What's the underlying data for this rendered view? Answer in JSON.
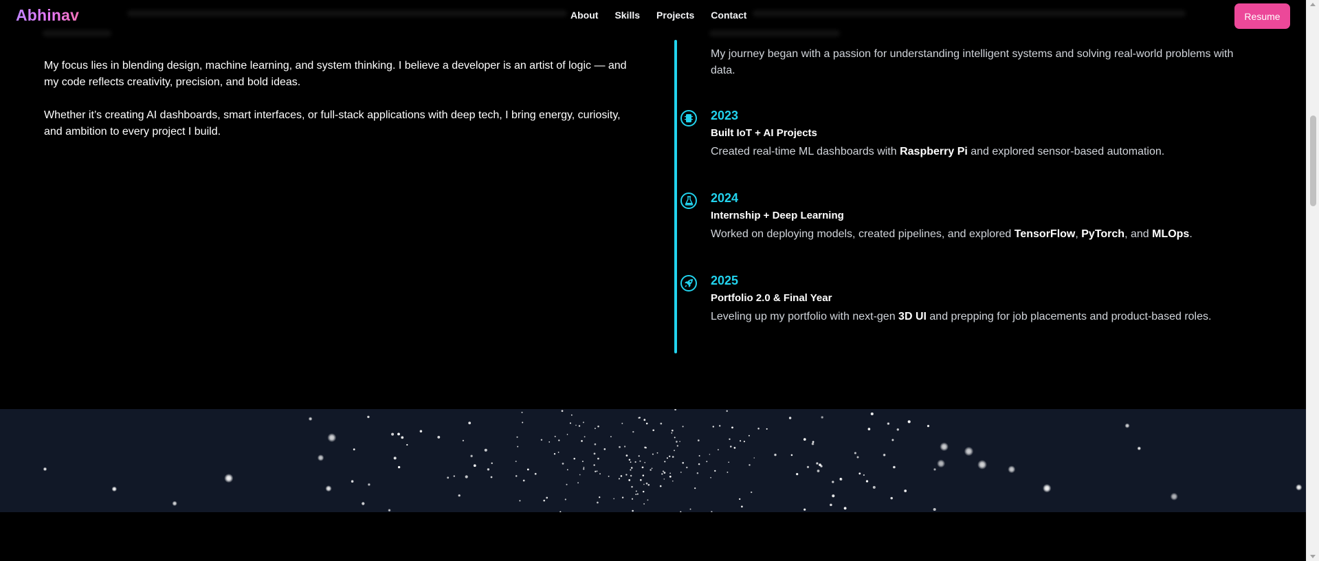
{
  "navbar": {
    "logo": "Abhinav",
    "links": [
      "About",
      "Skills",
      "Projects",
      "Contact"
    ],
    "resume_label": "Resume"
  },
  "about": {
    "paragraphs": [
      "My focus lies in blending design, machine learning, and system thinking. I believe a developer is an artist of logic — and my code reflects creativity, precision, and bold ideas.",
      "Whether it’s creating AI dashboards, smart interfaces, or full-stack applications with deep tech, I bring energy, curiosity, and ambition to every project I build."
    ]
  },
  "timeline": {
    "intro": "My journey began with a passion for understanding intelligent systems and solving real-world problems with data.",
    "items": [
      {
        "year": "2023",
        "title": "Built IoT + AI Projects",
        "icon": "microchip-icon",
        "desc": [
          {
            "text": "Created real-time ML dashboards with ",
            "bold": false
          },
          {
            "text": "Raspberry Pi",
            "bold": true
          },
          {
            "text": " and explored sensor-based automation.",
            "bold": false
          }
        ]
      },
      {
        "year": "2024",
        "title": "Internship + Deep Learning",
        "icon": "flask-icon",
        "desc": [
          {
            "text": "Worked on deploying models, created pipelines, and explored ",
            "bold": false
          },
          {
            "text": "TensorFlow",
            "bold": true
          },
          {
            "text": ", ",
            "bold": false
          },
          {
            "text": "PyTorch",
            "bold": true
          },
          {
            "text": ", and ",
            "bold": false
          },
          {
            "text": "MLOps",
            "bold": true
          },
          {
            "text": ".",
            "bold": false
          }
        ]
      },
      {
        "year": "2025",
        "title": "Portfolio 2.0 & Final Year",
        "icon": "rocket-icon",
        "desc": [
          {
            "text": "Leveling up my portfolio with next-gen ",
            "bold": false
          },
          {
            "text": "3D UI",
            "bold": true
          },
          {
            "text": " and prepping for job placements and product-based roles.",
            "bold": false
          }
        ]
      }
    ]
  },
  "colors": {
    "accent": "#22d3ee",
    "resume": "#ec4899",
    "starfield_bg": "#111827",
    "logo_gradient": [
      "#c084fc",
      "#f472b6"
    ]
  }
}
